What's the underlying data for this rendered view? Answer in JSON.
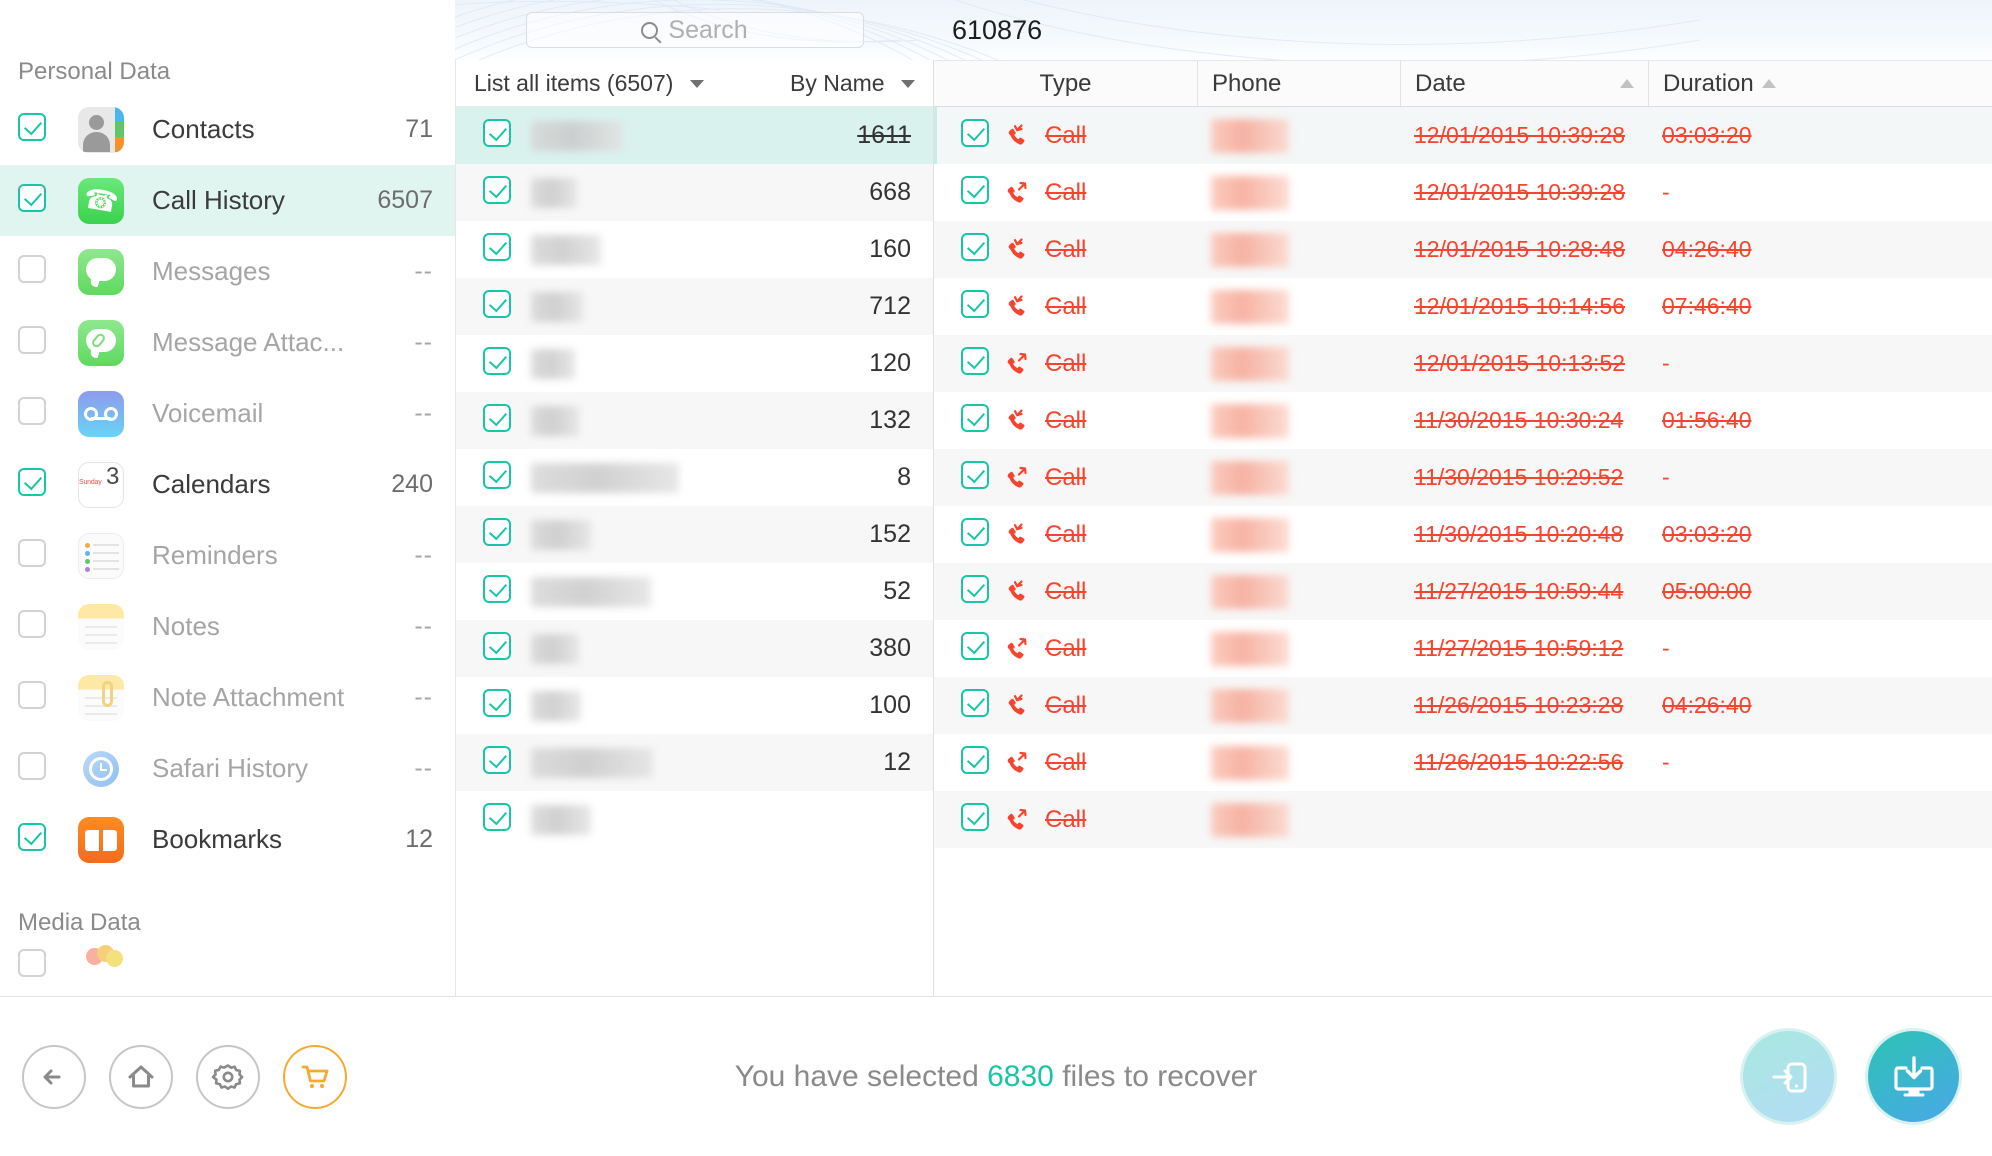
{
  "window": {
    "traffic_lights": [
      "close",
      "minimize",
      "zoom"
    ],
    "colors": {
      "accent_teal": "#18c5a9",
      "deleted_red": "#f7442e",
      "cart_orange": "#f6ab2f",
      "selected_row": "#d9f2ee"
    }
  },
  "sidebar": {
    "sections": [
      {
        "title": "Personal Data"
      },
      {
        "title": "Media Data"
      }
    ],
    "items": [
      {
        "label": "Contacts",
        "count": "71",
        "checked": true,
        "enabled": true,
        "icon": "contacts-icon"
      },
      {
        "label": "Call History",
        "count": "6507",
        "checked": true,
        "enabled": true,
        "icon": "phone-icon",
        "active": true
      },
      {
        "label": "Messages",
        "count": "--",
        "checked": false,
        "enabled": false,
        "icon": "messages-icon"
      },
      {
        "label": "Message Attac...",
        "count": "--",
        "checked": false,
        "enabled": false,
        "icon": "message-attachment-icon"
      },
      {
        "label": "Voicemail",
        "count": "--",
        "checked": false,
        "enabled": false,
        "icon": "voicemail-icon"
      },
      {
        "label": "Calendars",
        "count": "240",
        "checked": true,
        "enabled": true,
        "icon": "calendar-icon"
      },
      {
        "label": "Reminders",
        "count": "--",
        "checked": false,
        "enabled": false,
        "icon": "reminders-icon"
      },
      {
        "label": "Notes",
        "count": "--",
        "checked": false,
        "enabled": false,
        "icon": "notes-icon"
      },
      {
        "label": "Note Attachment",
        "count": "--",
        "checked": false,
        "enabled": false,
        "icon": "note-attachment-icon"
      },
      {
        "label": "Safari History",
        "count": "--",
        "checked": false,
        "enabled": false,
        "icon": "safari-icon"
      },
      {
        "label": "Bookmarks",
        "count": "12",
        "checked": true,
        "enabled": true,
        "icon": "bookmarks-icon"
      }
    ],
    "calendar_icon": {
      "weekday": "Sunday",
      "day": "3"
    }
  },
  "middle": {
    "search": {
      "placeholder": "Search",
      "value": ""
    },
    "filter_label": "List all items (6507)",
    "sort_label": "By Name",
    "rows": [
      {
        "count": "1611",
        "checked": true,
        "selected": true,
        "deleted": true,
        "name_width": 92
      },
      {
        "count": "668",
        "checked": true,
        "selected": false,
        "deleted": false,
        "name_width": 46
      },
      {
        "count": "160",
        "checked": true,
        "selected": false,
        "deleted": false,
        "name_width": 70
      },
      {
        "count": "712",
        "checked": true,
        "selected": false,
        "deleted": false,
        "name_width": 52
      },
      {
        "count": "120",
        "checked": true,
        "selected": false,
        "deleted": false,
        "name_width": 44
      },
      {
        "count": "132",
        "checked": true,
        "selected": false,
        "deleted": false,
        "name_width": 48
      },
      {
        "count": "8",
        "checked": true,
        "selected": false,
        "deleted": false,
        "name_width": 148
      },
      {
        "count": "152",
        "checked": true,
        "selected": false,
        "deleted": false,
        "name_width": 60
      },
      {
        "count": "52",
        "checked": true,
        "selected": false,
        "deleted": false,
        "name_width": 120
      },
      {
        "count": "380",
        "checked": true,
        "selected": false,
        "deleted": false,
        "name_width": 48
      },
      {
        "count": "100",
        "checked": true,
        "selected": false,
        "deleted": false,
        "name_width": 50
      },
      {
        "count": "12",
        "checked": true,
        "selected": false,
        "deleted": false,
        "name_width": 122
      },
      {
        "count": "",
        "checked": true,
        "selected": false,
        "deleted": false,
        "name_width": 60
      }
    ]
  },
  "detail": {
    "title": "610876",
    "columns": [
      {
        "label": "Type",
        "sortable": false
      },
      {
        "label": "Phone",
        "sortable": false
      },
      {
        "label": "Date",
        "sortable": true
      },
      {
        "label": "Duration",
        "sortable": true
      }
    ],
    "rows": [
      {
        "checked": true,
        "type": "Call",
        "direction": "incoming",
        "date": "12/01/2015 10:39:28",
        "duration": "03:03:20",
        "deleted": true,
        "selected": true
      },
      {
        "checked": true,
        "type": "Call",
        "direction": "outgoing",
        "date": "12/01/2015 10:39:28",
        "duration": "-",
        "deleted": true,
        "selected": false
      },
      {
        "checked": true,
        "type": "Call",
        "direction": "incoming",
        "date": "12/01/2015 10:28:48",
        "duration": "04:26:40",
        "deleted": true,
        "selected": false
      },
      {
        "checked": true,
        "type": "Call",
        "direction": "incoming",
        "date": "12/01/2015 10:14:56",
        "duration": "07:46:40",
        "deleted": true,
        "selected": false
      },
      {
        "checked": true,
        "type": "Call",
        "direction": "outgoing",
        "date": "12/01/2015 10:13:52",
        "duration": "-",
        "deleted": true,
        "selected": false
      },
      {
        "checked": true,
        "type": "Call",
        "direction": "incoming",
        "date": "11/30/2015 10:30:24",
        "duration": "01:56:40",
        "deleted": true,
        "selected": false
      },
      {
        "checked": true,
        "type": "Call",
        "direction": "outgoing",
        "date": "11/30/2015 10:29:52",
        "duration": "-",
        "deleted": true,
        "selected": false
      },
      {
        "checked": true,
        "type": "Call",
        "direction": "incoming",
        "date": "11/30/2015 10:20:48",
        "duration": "03:03:20",
        "deleted": true,
        "selected": false
      },
      {
        "checked": true,
        "type": "Call",
        "direction": "incoming",
        "date": "11/27/2015 10:59:44",
        "duration": "05:00:00",
        "deleted": true,
        "selected": false
      },
      {
        "checked": true,
        "type": "Call",
        "direction": "outgoing",
        "date": "11/27/2015 10:59:12",
        "duration": "-",
        "deleted": true,
        "selected": false
      },
      {
        "checked": true,
        "type": "Call",
        "direction": "incoming",
        "date": "11/26/2015 10:23:28",
        "duration": "04:26:40",
        "deleted": true,
        "selected": false
      },
      {
        "checked": true,
        "type": "Call",
        "direction": "outgoing",
        "date": "11/26/2015 10:22:56",
        "duration": "-",
        "deleted": true,
        "selected": false
      },
      {
        "checked": true,
        "type": "Call",
        "direction": "outgoing",
        "date": "",
        "duration": "",
        "deleted": true,
        "selected": false
      }
    ]
  },
  "bottom": {
    "back_label": "back-arrow",
    "home_label": "home",
    "settings_label": "settings",
    "cart_label": "cart",
    "status_prefix": "You have selected ",
    "status_count": "6830",
    "status_suffix": " files to recover",
    "recover_to_device_label": "recover-to-device",
    "recover_to_computer_label": "recover-to-computer"
  }
}
